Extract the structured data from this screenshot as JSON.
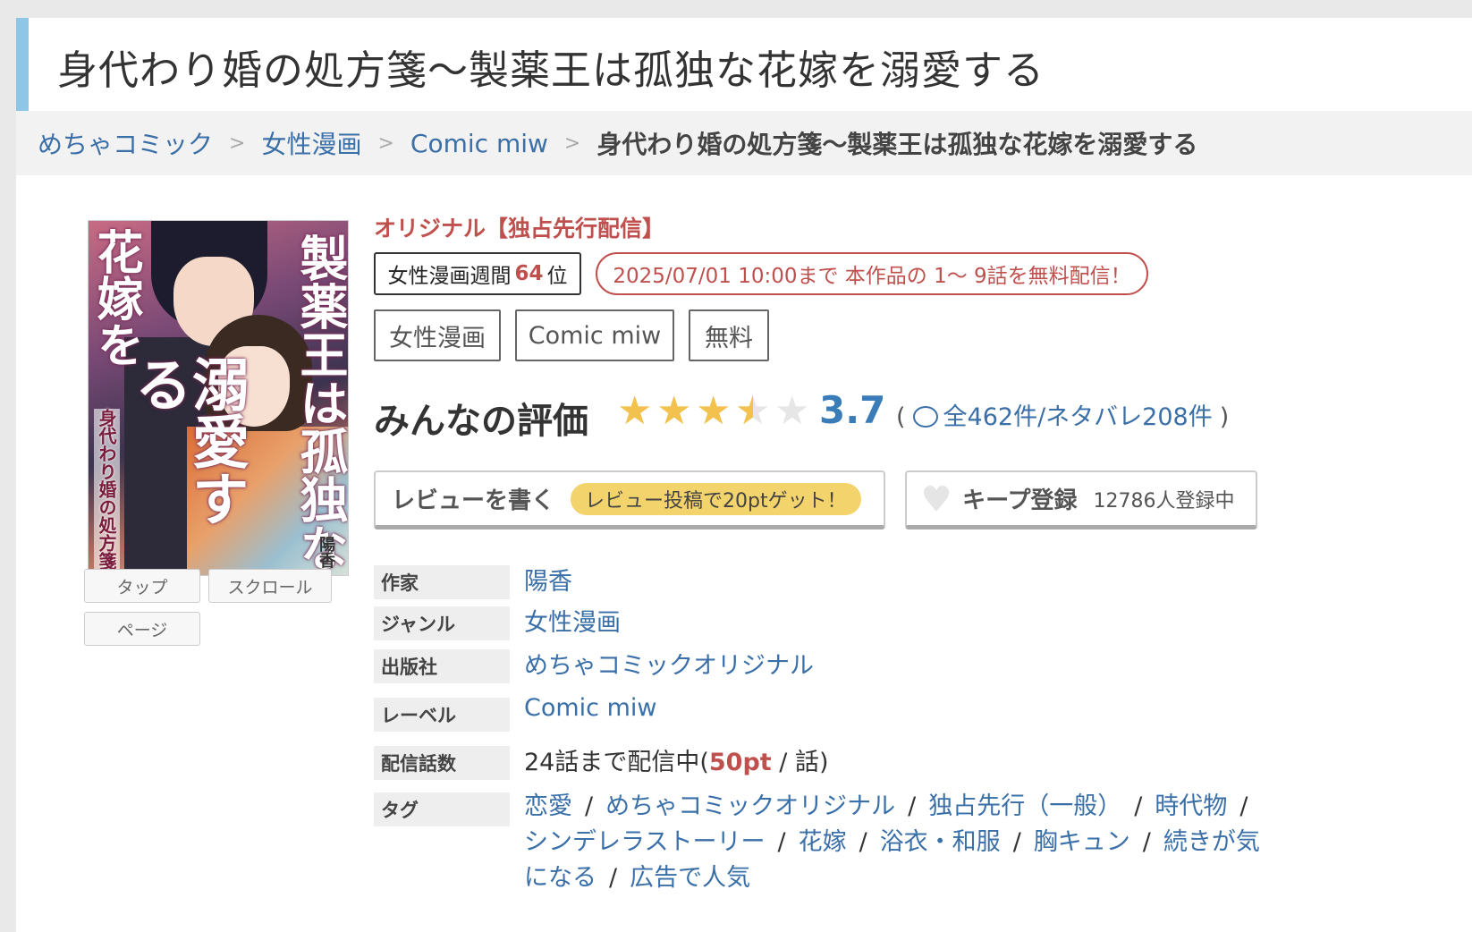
{
  "title": "身代わり婚の処方箋〜製薬王は孤独な花嫁を溺愛する",
  "breadcrumb": {
    "items": [
      "めちゃコミック",
      "女性漫画",
      "Comic miw"
    ],
    "separator": ">",
    "current": "身代わり婚の処方箋〜製薬王は孤独な花嫁を溺愛する"
  },
  "cover": {
    "title_main": "製薬王は孤独な",
    "title_left": "花嫁を",
    "title_big": "溺愛する",
    "subtitle": "身代わり婚の処方箋",
    "author": "陽香"
  },
  "view_buttons": [
    "タップ",
    "スクロール",
    "ページ"
  ],
  "original_label": "オリジナル【独占先行配信】",
  "rank": {
    "prefix": "女性漫画週間",
    "number": "64",
    "suffix": "位"
  },
  "free_notice": "2025/07/01 10:00まで 本作品の 1〜 9話を無料配信！",
  "tag_buttons": [
    "女性漫画",
    "Comic miw",
    "無料"
  ],
  "rating": {
    "title": "みんなの評価",
    "score": "3.7",
    "score_value": 3.7,
    "stars_max": 5,
    "open_paren": "(",
    "review_text": "全462件/ネタバレ208件",
    "close_paren": ")"
  },
  "actions": {
    "review_label": "レビューを書く",
    "review_bonus": "レビュー投稿で20ptゲット！",
    "keep_label": "キープ登録",
    "keep_count": "12786人登録中"
  },
  "info": {
    "author_label": "作家",
    "author": "陽香",
    "genre_label": "ジャンル",
    "genre": "女性漫画",
    "publisher_label": "出版社",
    "publisher": "めちゃコミックオリジナル",
    "label_label": "レーベル",
    "label": "Comic miw",
    "episodes_label": "配信話数",
    "episodes_prefix": "24話まで配信中(",
    "episodes_pt": "50pt",
    "episodes_suffix": " / 話)",
    "tags_label": "タグ",
    "tags": [
      "恋愛",
      "めちゃコミックオリジナル",
      "独占先行（一般）",
      "時代物",
      "シンデレラストーリー",
      "花嫁",
      "浴衣・和服",
      "胸キュン",
      "続きが気になる",
      "広告で人気"
    ]
  },
  "colors": {
    "accent_blue": "#8ec6e6",
    "link": "#3a6fa8",
    "red": "#c0504d",
    "star": "#f2c14e",
    "bonus_yellow": "#f3d36b"
  }
}
